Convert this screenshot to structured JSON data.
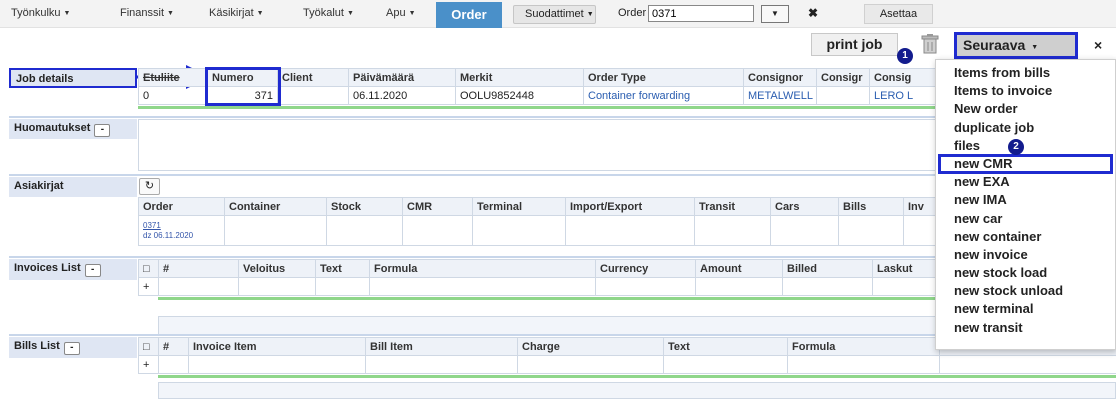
{
  "topmenu": {
    "items": [
      "Työnkulku",
      "Finanssit",
      "Käsikirjat",
      "Työkalut",
      "Apu"
    ],
    "active_tab": "Order",
    "filter_button": "Suodattimet",
    "order_label": "Order",
    "order_value": "0371",
    "clear_icon": "✖",
    "set_button": "Asettaa"
  },
  "actions": {
    "print_job": "print job",
    "next_button": "Seuraava",
    "close": "×",
    "badges": [
      "1",
      "2"
    ]
  },
  "job_details": {
    "label": "Job details",
    "headers": [
      "Etuliite",
      "Numero",
      "Client",
      "Päivämäärä",
      "Merkit",
      "Order Type",
      "Consignor",
      "Consigr",
      "Consig"
    ],
    "row": [
      "0",
      "371",
      "",
      "06.11.2020",
      "OOLU9852448",
      "Container forwarding",
      "METALWELL",
      "",
      "LERO L"
    ]
  },
  "notes": {
    "label": "Huomautukset",
    "toggle": "-"
  },
  "documents": {
    "label": "Asiakirjat",
    "refresh_icon": "↻",
    "headers": [
      "Order",
      "Container",
      "Stock",
      "CMR",
      "Terminal",
      "Import/Export",
      "Transit",
      "Cars",
      "Bills",
      "Inv"
    ],
    "order_link": "0371",
    "order_link_date": "dz 06.11.2020"
  },
  "invoices": {
    "label": "Invoices List",
    "toggle": "-",
    "headers": [
      "□",
      "#",
      "Veloitus",
      "Text",
      "Formula",
      "Currency",
      "Amount",
      "Billed",
      "Laskut"
    ],
    "add": "+"
  },
  "bills": {
    "label": "Bills List",
    "toggle": "-",
    "headers": [
      "□",
      "#",
      "Invoice Item",
      "Bill Item",
      "Charge",
      "Text",
      "Formula",
      ""
    ],
    "add": "+"
  },
  "dropdown_menu": [
    "Items from bills",
    "Items to invoice",
    "New order",
    "duplicate job",
    "files",
    "new CMR",
    "new EXA",
    "new IMA",
    "new car",
    "new container",
    "new invoice",
    "new stock load",
    "new stock unload",
    "new terminal",
    "new transit"
  ],
  "highlighted_item": "new CMR",
  "colors": {
    "accent": "#4a90c9",
    "annotation": "#1f2bd0",
    "header_bg": "#dfe6f3",
    "green_line": "#8fd68a"
  }
}
